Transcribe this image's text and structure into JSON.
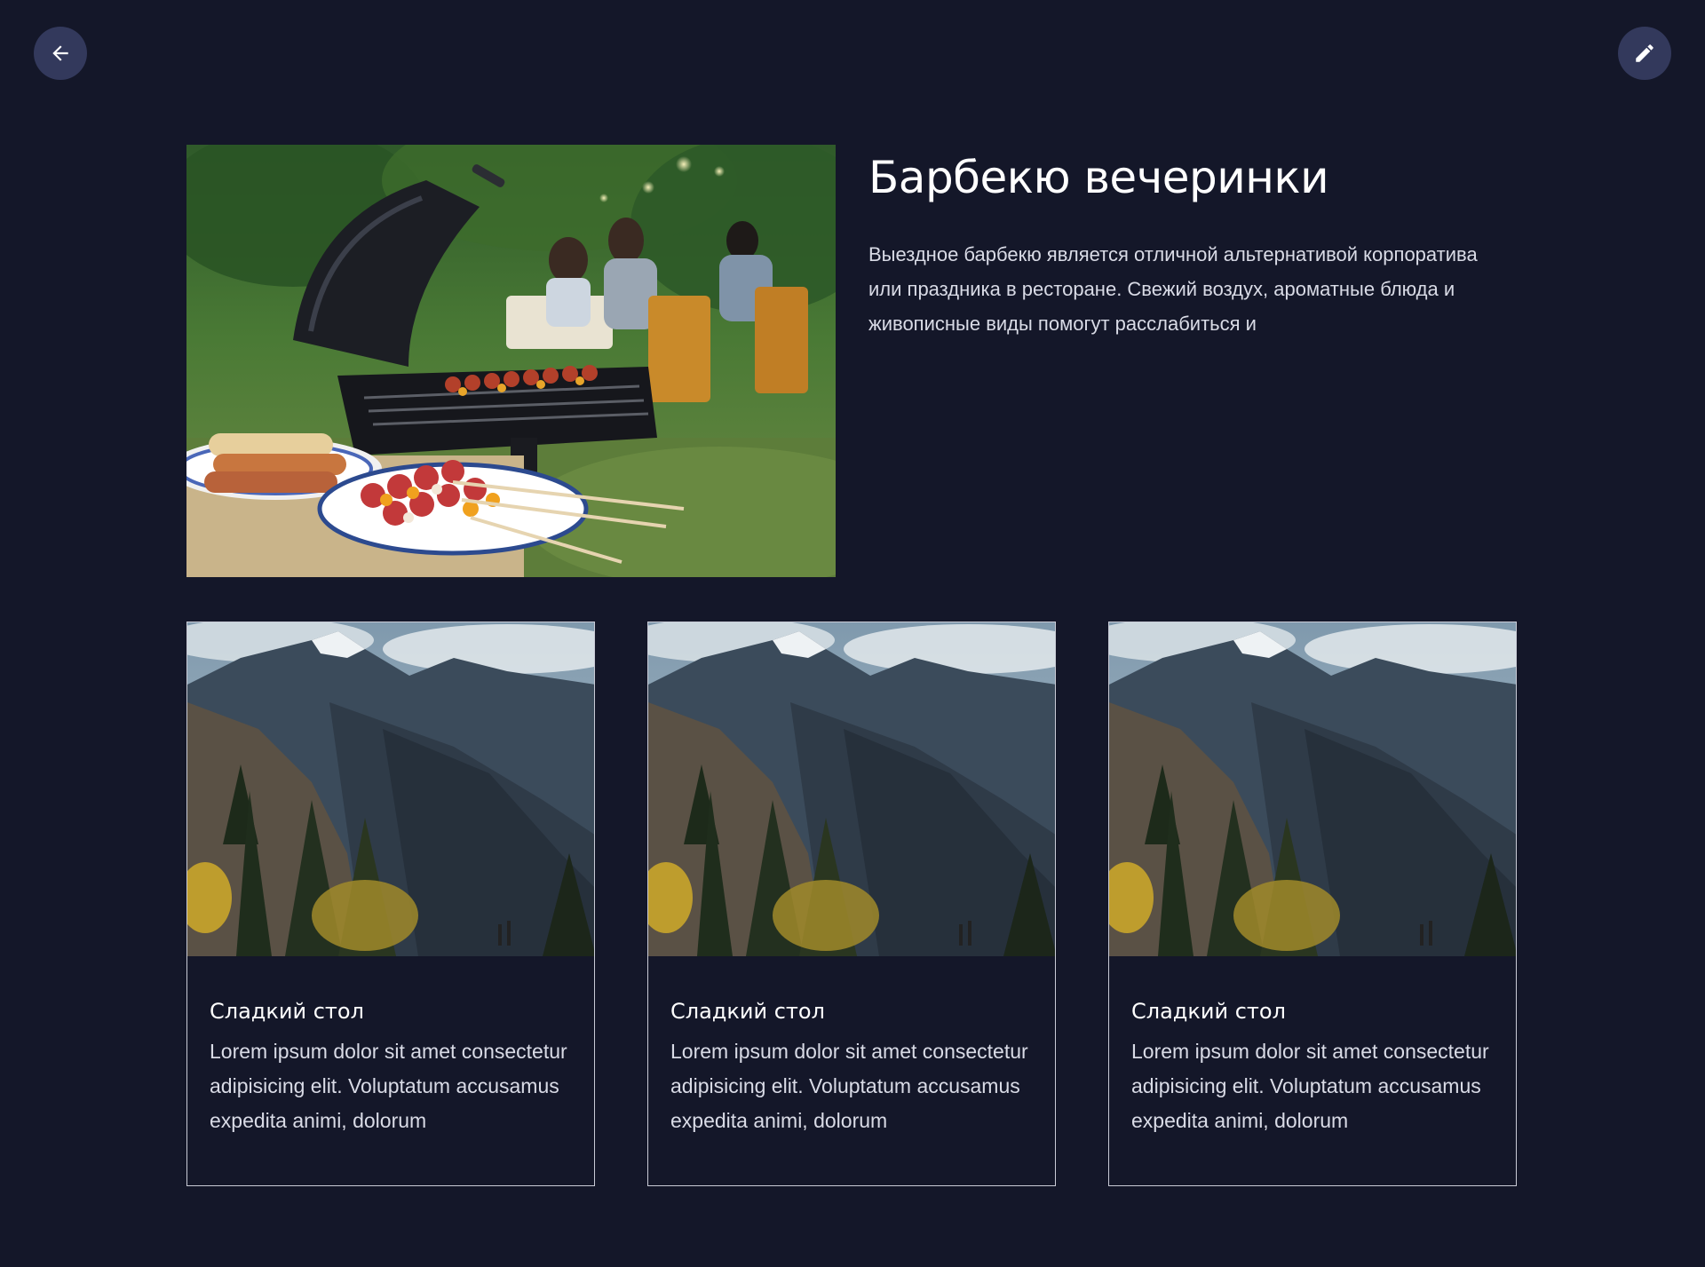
{
  "header": {
    "back_icon": "arrow-left-icon",
    "edit_icon": "pencil-icon"
  },
  "hero": {
    "image": "barbecue-grill-photo",
    "title": "Барбекю вечеринки",
    "description": "Выездное барбекю является отличной альтернативой корпоратива или праздника в ресторане. Свежий воздух, ароматные блюда и живописные виды помогут расслабиться и"
  },
  "cards": [
    {
      "image": "mountain-landscape-photo",
      "title": "Сладкий стол",
      "text": "Lorem ipsum dolor sit amet consectetur adipisicing elit. Voluptatum accusamus expedita animi, dolorum"
    },
    {
      "image": "mountain-landscape-photo",
      "title": "Сладкий стол",
      "text": "Lorem ipsum dolor sit amet consectetur adipisicing elit. Voluptatum accusamus expedita animi, dolorum"
    },
    {
      "image": "mountain-landscape-photo",
      "title": "Сладкий стол",
      "text": "Lorem ipsum dolor sit amet consectetur adipisicing elit. Voluptatum accusamus expedita animi, dolorum"
    }
  ],
  "colors": {
    "background": "#141729",
    "button_bg": "#33395c",
    "card_border": "#c9cbd6",
    "text_primary": "#ffffff",
    "text_secondary": "#d9dbe6"
  }
}
